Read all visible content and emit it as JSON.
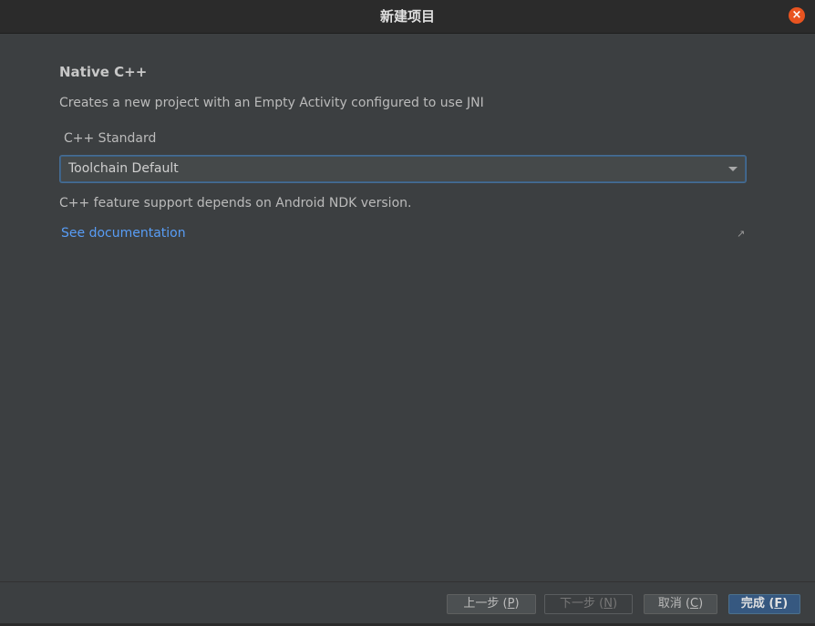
{
  "window": {
    "title": "新建项目",
    "close_label": "×"
  },
  "content": {
    "heading": "Native C++",
    "description": "Creates a new project with an Empty Activity configured to use JNI",
    "standard_label": "C++ Standard",
    "standard_value": "Toolchain Default",
    "note": "C++ feature support depends on Android NDK version.",
    "doc_link": "See documentation",
    "external_icon": "↗"
  },
  "buttons": {
    "previous": {
      "label": "上一步 (",
      "mnemonic": "P",
      "suffix": ")"
    },
    "next": {
      "label": "下一步 (",
      "mnemonic": "N",
      "suffix": ")"
    },
    "cancel": {
      "label": "取消 (",
      "mnemonic": "C",
      "suffix": ")"
    },
    "finish": {
      "label": "完成 (",
      "mnemonic": "F",
      "suffix": ")"
    }
  },
  "colors": {
    "background": "#3c3f41",
    "titlebar": "#2b2b2b",
    "link": "#589df6",
    "close": "#e95420",
    "primary_button": "#365880"
  }
}
